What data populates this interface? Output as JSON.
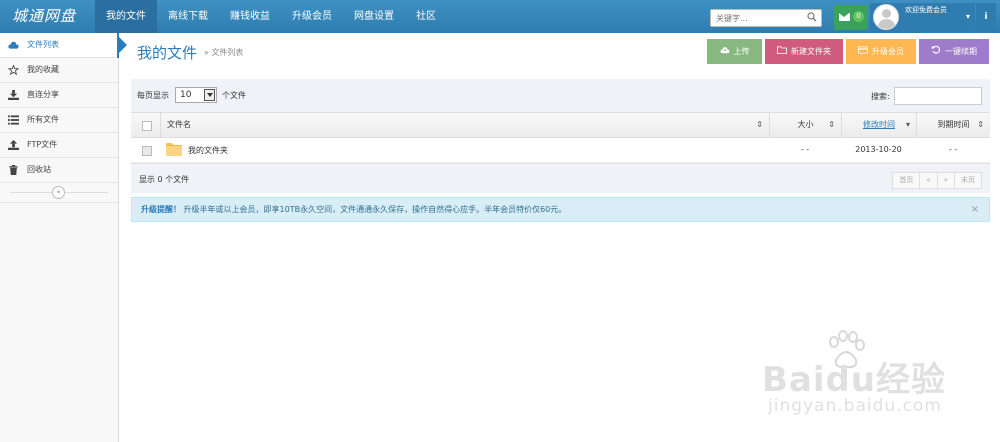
{
  "app": {
    "logo": "城通网盘"
  },
  "nav": {
    "items": [
      {
        "label": "我的文件",
        "active": true
      },
      {
        "label": "离线下载"
      },
      {
        "label": "赚钱收益"
      },
      {
        "label": "升级会员"
      },
      {
        "label": "网盘设置"
      },
      {
        "label": "社区"
      }
    ]
  },
  "topsearch": {
    "placeholder": "关键字..."
  },
  "messages": {
    "count": "0"
  },
  "user": {
    "welcome": "欢迎免费会员"
  },
  "sidebar": {
    "items": [
      {
        "label": "文件列表",
        "icon": "cloud-icon",
        "active": true
      },
      {
        "label": "我的收藏",
        "icon": "star-icon"
      },
      {
        "label": "直连分享",
        "icon": "download-icon"
      },
      {
        "label": "所有文件",
        "icon": "list-icon"
      },
      {
        "label": "FTP文件",
        "icon": "upload-icon"
      },
      {
        "label": "回收站",
        "icon": "trash-icon"
      }
    ],
    "collapse": "«"
  },
  "header": {
    "title": "我的文件",
    "breadcrumb": "» 文件列表"
  },
  "actions": {
    "upload": "上传",
    "new_folder": "新建文件夹",
    "upgrade": "升级会员",
    "renew": "一键续期"
  },
  "table_controls": {
    "per_page_label": "每页显示",
    "per_page_value": "10",
    "per_page_suffix": "个文件",
    "search_label": "搜索:"
  },
  "table": {
    "columns": [
      "文件名",
      "大小",
      "修改时间",
      "到期时间"
    ],
    "rows": [
      {
        "name": "我的文件夹",
        "size": "- -",
        "modified": "2013-10-20",
        "expires": "- -"
      }
    ]
  },
  "footer": {
    "count_text": "显示 0 个文件",
    "pager": [
      "首页",
      "«",
      "»",
      "末页"
    ]
  },
  "alert": {
    "title": "升级提醒！",
    "text": "升级半年或以上会员，即享10TB永久空间，文件通通永久保存，操作自然得心应手。半年会员特价仅60元。",
    "close": "×"
  },
  "watermark": {
    "brand": "Baidu经验",
    "url": "jingyan.baidu.com"
  },
  "colors": {
    "nav_bg": "#3c8dbc",
    "accent": "#2b7dbc",
    "upload": "#87b87f",
    "new_folder": "#d15b7f",
    "upgrade": "#ffb752",
    "renew": "#9e7bcb",
    "alert_bg": "#d9edf7"
  }
}
